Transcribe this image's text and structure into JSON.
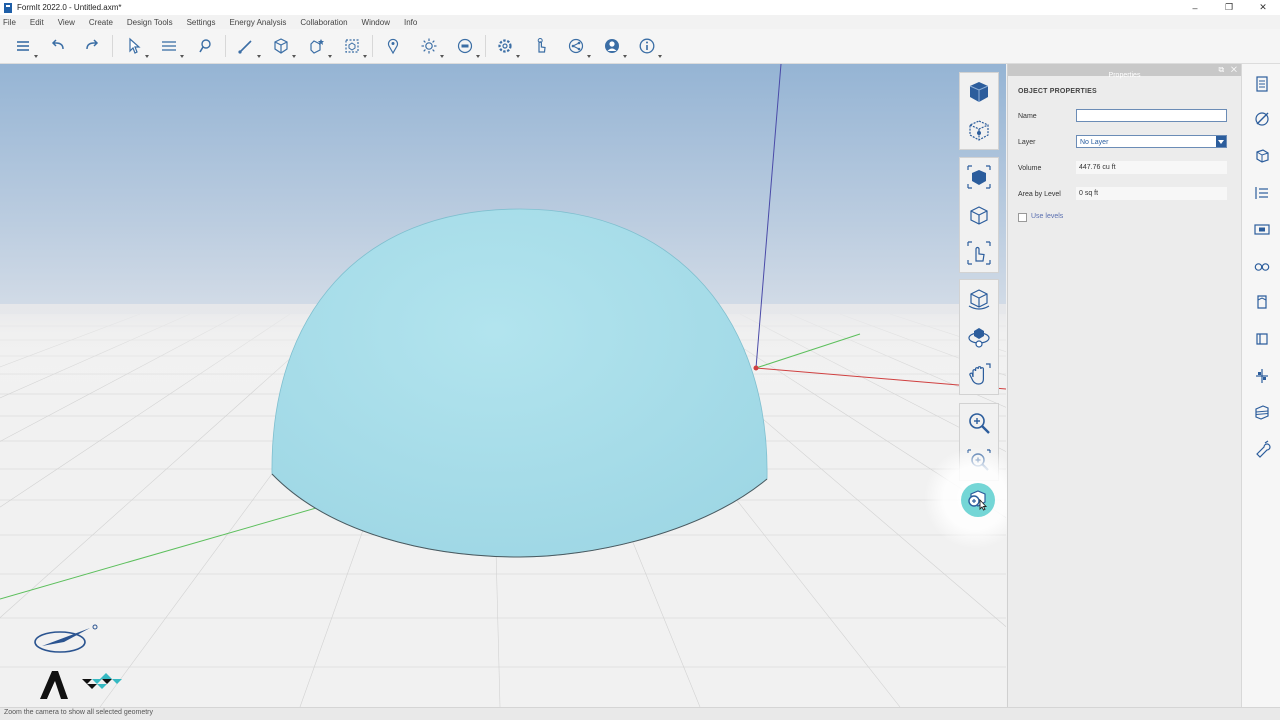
{
  "window": {
    "title": "FormIt 2022.0 - Untitled.axm*",
    "controls": [
      "–",
      "❐",
      "✕"
    ]
  },
  "menu": [
    "File",
    "Edit",
    "View",
    "Create",
    "Design Tools",
    "Settings",
    "Energy Analysis",
    "Collaboration",
    "Window",
    "Info"
  ],
  "toolbar": {
    "icons": [
      "layers-stack-icon",
      "undo-icon",
      "redo-icon",
      "select-icon",
      "measure-icon",
      "paint-icon",
      "draw-line-icon",
      "cube-icon",
      "magic-wand-icon",
      "group-icon",
      "location-pin-icon",
      "sun-icon",
      "scene-icon",
      "settings-gear-icon",
      "gesture-icon",
      "share-icon",
      "account-icon",
      "info-icon"
    ]
  },
  "properties": {
    "header": "Properties",
    "header_buttons": [
      "⧉",
      "✕"
    ],
    "section": "OBJECT PROPERTIES",
    "name_label": "Name",
    "name_value": "",
    "layer_label": "Layer",
    "layer_value": "No Layer",
    "volume_label": "Volume",
    "volume_value": "447.76 cu ft",
    "area_label": "Area by Level",
    "area_value": "0 sq ft",
    "use_levels_label": "Use levels",
    "use_levels_checked": false
  },
  "view_tools": [
    "view-cube-icon",
    "axonometric-icon",
    "perspective-icon",
    "orthographic-icon",
    "look-around-icon",
    "orbit-icon",
    "orbit-select-icon",
    "pan-icon",
    "zoom-icon",
    "zoom-window-icon",
    "zoom-selected-icon"
  ],
  "rail_icons": [
    "properties-icon",
    "materials-icon",
    "groups-icon",
    "levels-icon",
    "scenes-icon",
    "visual-styles-icon",
    "components-icon",
    "solar-icon",
    "plugins-icon",
    "content-library-icon",
    "dynamo-icon"
  ],
  "status": {
    "text": "Zoom the camera to show all selected geometry"
  },
  "colors": {
    "dome": "#a8dde9",
    "accent": "#2c5d9c",
    "axis_x": "#d04040",
    "axis_y": "#5cbf5c",
    "axis_z": "#4a4aa8"
  }
}
